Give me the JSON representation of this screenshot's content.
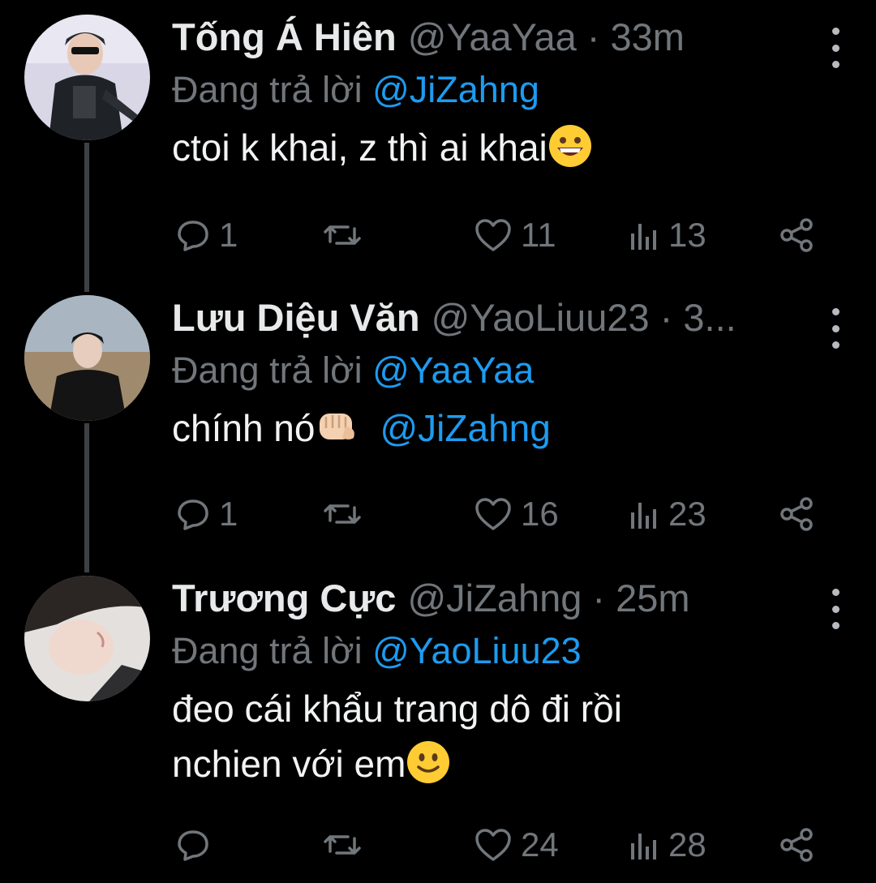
{
  "colors": {
    "background": "#000000",
    "accent": "#1d9bf0",
    "muted": "#71767b",
    "text": "#e7e9ea"
  },
  "tweets": [
    {
      "name": "Tống Á Hiên",
      "handle": "@YaaYaa",
      "time_sep": " · 33m",
      "reply_prefix": "Đang trả lời ",
      "reply_to": "@JiZahng",
      "text": "ctoi k khai, z thì ai khai",
      "text_emoji": "grinning-face",
      "mention": "",
      "replies": "1",
      "retweets": "",
      "likes": "11",
      "views": "13"
    },
    {
      "name": "Lưu Diệu Văn",
      "handle": "@YaoLiuu23",
      "time_sep": " · 3...",
      "reply_prefix": "Đang trả lời ",
      "reply_to": "@YaaYaa",
      "text": "chính nó",
      "text_emoji": "fist",
      "mention": "@JiZahng",
      "replies": "1",
      "retweets": "",
      "likes": "16",
      "views": "23"
    },
    {
      "name": "Trương Cực",
      "handle": "@JiZahng",
      "time_sep": " · 25m",
      "reply_prefix": "Đang trả lời ",
      "reply_to": "@YaoLiuu23",
      "text_line1": "đeo cái khẩu trang dô đi rồi",
      "text_line2": "nchien với em",
      "text_emoji": "slightly-smiling-face",
      "replies": "",
      "retweets": "",
      "likes": "24",
      "views": "28"
    }
  ],
  "icons": {
    "reply": "reply-icon",
    "retweet": "retweet-icon",
    "like": "heart-icon",
    "views": "views-icon",
    "share": "share-icon",
    "more": "more-icon"
  }
}
